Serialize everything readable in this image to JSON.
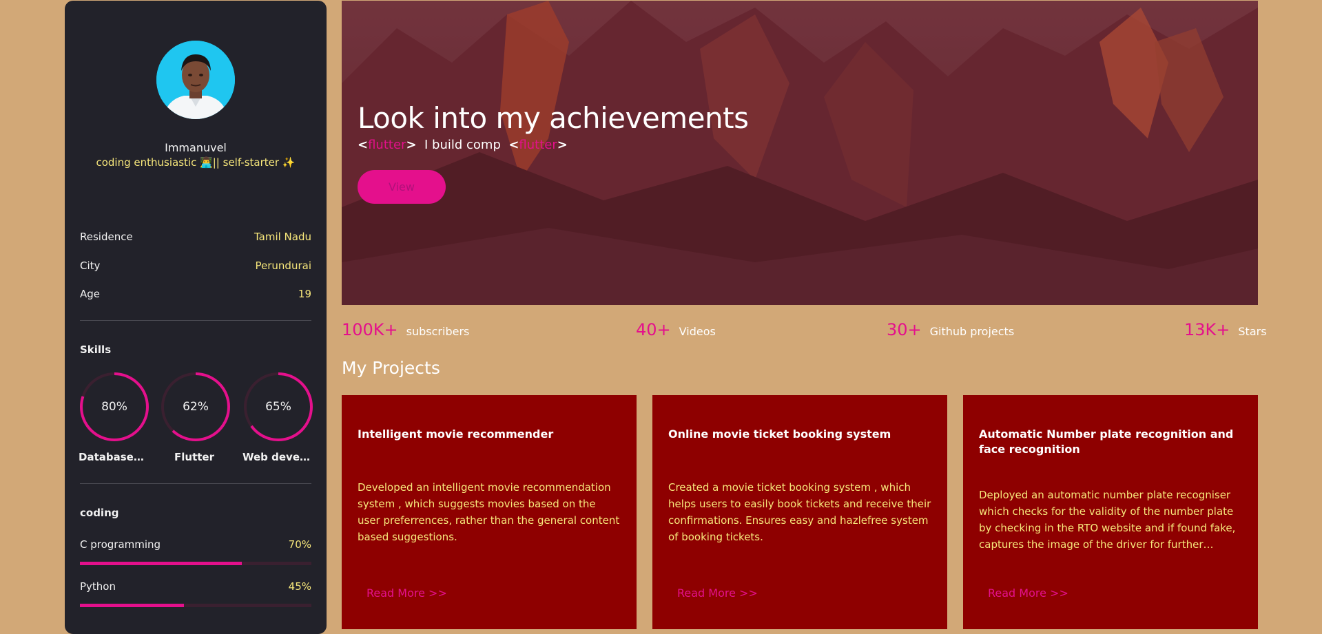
{
  "colors": {
    "page_bg": "#d2a877",
    "sidebar_bg": "#22222a",
    "accent": "#e4108c",
    "highlight": "#f7e77b",
    "card_bg": "#8e0000"
  },
  "profile": {
    "name": "Immanuvel",
    "tagline": "coding enthusiastic 👨‍💻|| self-starter ✨",
    "avatar_icon": "user-photo-icon"
  },
  "info": [
    {
      "label": "Residence",
      "value": "Tamil Nadu"
    },
    {
      "label": "City",
      "value": "Perundurai"
    },
    {
      "label": "Age",
      "value": "19"
    }
  ],
  "skills": {
    "title": "Skills",
    "items": [
      {
        "label": "Database ...",
        "percent_text": "80%",
        "percent": 80
      },
      {
        "label": "Flutter",
        "percent_text": "62%",
        "percent": 62
      },
      {
        "label": "Web devel...",
        "percent_text": "65%",
        "percent": 65
      }
    ]
  },
  "coding": {
    "title": "coding",
    "items": [
      {
        "label": "C programming",
        "percent_text": "70%",
        "percent": 70
      },
      {
        "label": "Python",
        "percent_text": "45%",
        "percent": 45
      }
    ]
  },
  "hero": {
    "title": "Look into my achievements",
    "tag_open": "<",
    "tag_name": "flutter",
    "tag_close": ">",
    "typed_text": "I build comp",
    "view_label": "View"
  },
  "stats": [
    {
      "number": "100K+",
      "label": "subscribers"
    },
    {
      "number": "40+",
      "label": "Videos"
    },
    {
      "number": "30+",
      "label": "Github projects"
    },
    {
      "number": "13K+",
      "label": "Stars"
    }
  ],
  "projects": {
    "title": "My Projects",
    "read_more_label": "Read More >>",
    "items": [
      {
        "title": "Intelligent movie recommender",
        "description": "Developed an intelligent movie recommendation system , which suggests movies based on the user preferrences, rather than the general content based suggestions."
      },
      {
        "title": "Online movie ticket booking system",
        "description": "Created a movie ticket booking system , which helps users to easily book tickets and receive their confirmations. Ensures easy and hazlefree system of booking tickets."
      },
      {
        "title": "Automatic Number plate recognition and face recognition",
        "description": "Deployed an automatic number plate recogniser which checks for the validity of the number plate by checking in the RTO website and if found fake, captures the image of the driver for further investig..."
      }
    ]
  }
}
